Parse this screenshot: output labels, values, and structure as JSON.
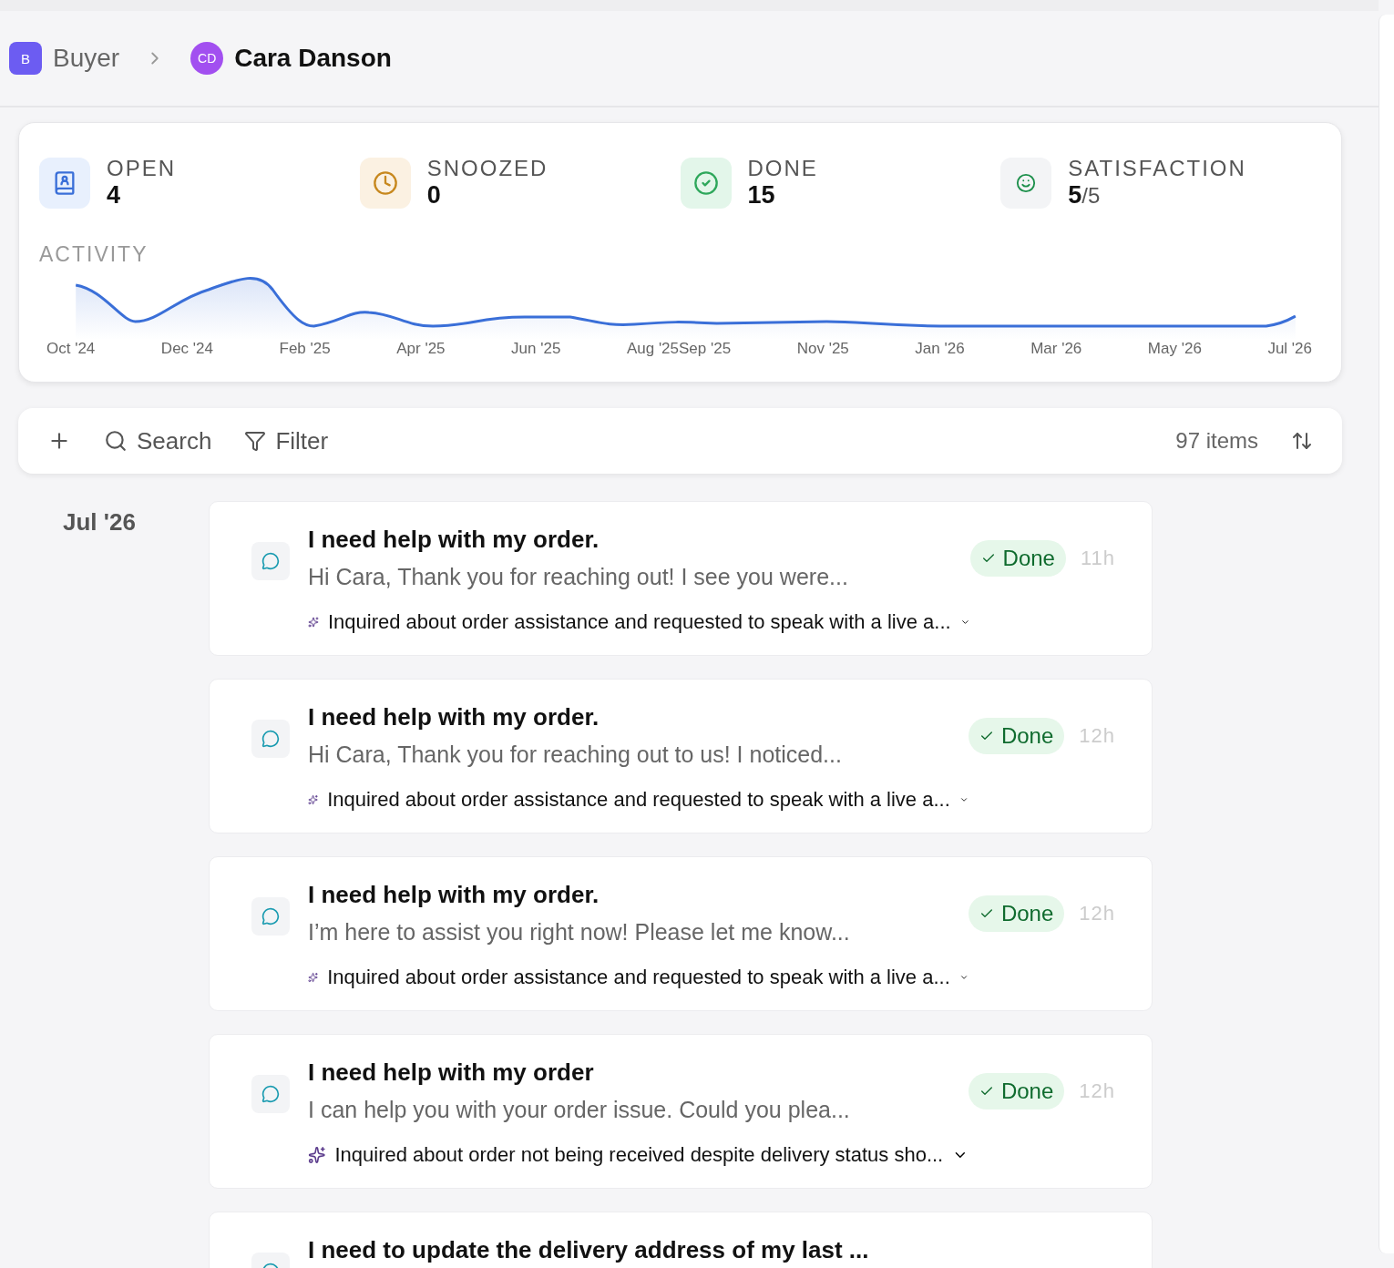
{
  "breadcrumb": {
    "workspace": {
      "initial": "B",
      "label": "Buyer"
    },
    "contact": {
      "initials": "CD",
      "name": "Cara Danson"
    }
  },
  "stats": [
    {
      "kind": "open",
      "label": "OPEN",
      "value": "4"
    },
    {
      "kind": "snoozed",
      "label": "SNOOZED",
      "value": "0"
    },
    {
      "kind": "done",
      "label": "DONE",
      "value": "15"
    },
    {
      "kind": "satisfaction",
      "label": "SATISFACTION",
      "value": "5",
      "suffix": "/5"
    }
  ],
  "activity": {
    "title": "ACTIVITY",
    "months": [
      "Oct '24",
      "Dec '24",
      "Feb '25",
      "Apr '25",
      "Jun '25",
      "Aug '25Sep '25",
      "Nov '25",
      "Jan '26",
      "Mar '26",
      "May '26",
      "Jul '26"
    ]
  },
  "toolbar": {
    "search": "Search",
    "filter": "Filter",
    "count": "97 items"
  },
  "group": {
    "label": "Jul '26"
  },
  "conversations": [
    {
      "title": "I need help with my order.",
      "preview": "Hi Cara, Thank you for reaching out! I see you were...",
      "status": "Done",
      "age": "11h",
      "summary": "Inquired about order assistance and requested to speak with a live a..."
    },
    {
      "title": "I need help with my order.",
      "preview": "Hi Cara, Thank you for reaching out to us! I noticed...",
      "status": "Done",
      "age": "12h",
      "summary": "Inquired about order assistance and requested to speak with a live a..."
    },
    {
      "title": "I need help with my order.",
      "preview": "I’m here to assist you right now! Please let me know...",
      "status": "Done",
      "age": "12h",
      "summary": "Inquired about order assistance and requested to speak with a live a..."
    },
    {
      "title": "I need help with my order",
      "preview": "I can help you with your order issue. Could you plea...",
      "status": "Done",
      "age": "12h",
      "summary": "Inquired about order not being received despite delivery status sho..."
    },
    {
      "title": "I need to update the delivery address of my last ..."
    }
  ]
}
